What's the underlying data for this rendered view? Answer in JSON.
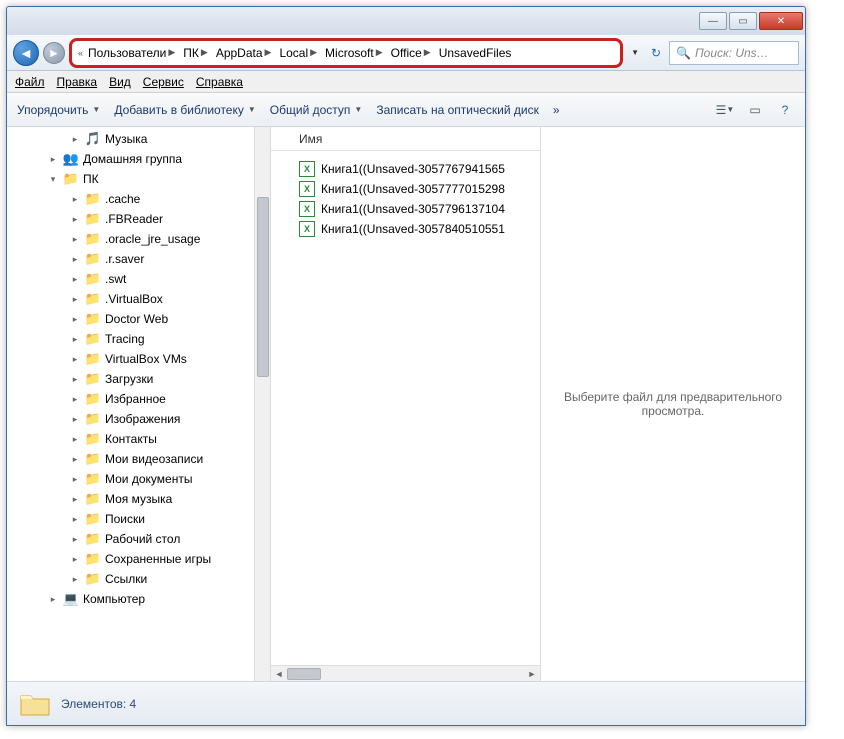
{
  "window": {
    "minimize": "—",
    "maximize": "▭",
    "close": "✕"
  },
  "breadcrumbs": {
    "prefix": "«",
    "items": [
      "Пользователи",
      "ПК",
      "AppData",
      "Local",
      "Microsoft",
      "Office",
      "UnsavedFiles"
    ]
  },
  "search": {
    "placeholder": "Поиск: Uns…"
  },
  "menubar": {
    "file": "Файл",
    "edit": "Правка",
    "view": "Вид",
    "service": "Сервис",
    "help": "Справка"
  },
  "toolbar": {
    "organize": "Упорядочить",
    "add_to_library": "Добавить в библиотеку",
    "share": "Общий доступ",
    "burn": "Записать на оптический диск",
    "more": "»"
  },
  "sidebar": {
    "items": [
      {
        "label": "Музыка",
        "icon": "🎵",
        "indent": 2
      },
      {
        "label": "Домашняя группа",
        "icon": "👥",
        "indent": 1
      },
      {
        "label": "ПК",
        "icon": "📁",
        "indent": 1,
        "expanded": true
      },
      {
        "label": ".cache",
        "icon": "📁",
        "indent": 2
      },
      {
        "label": ".FBReader",
        "icon": "📁",
        "indent": 2
      },
      {
        "label": ".oracle_jre_usage",
        "icon": "📁",
        "indent": 2
      },
      {
        "label": ".r.saver",
        "icon": "📁",
        "indent": 2
      },
      {
        "label": ".swt",
        "icon": "📁",
        "indent": 2
      },
      {
        "label": ".VirtualBox",
        "icon": "📁",
        "indent": 2
      },
      {
        "label": "Doctor Web",
        "icon": "📁",
        "indent": 2
      },
      {
        "label": "Tracing",
        "icon": "📁",
        "indent": 2
      },
      {
        "label": "VirtualBox VMs",
        "icon": "📁",
        "indent": 2
      },
      {
        "label": "Загрузки",
        "icon": "📁",
        "indent": 2
      },
      {
        "label": "Избранное",
        "icon": "📁",
        "indent": 2
      },
      {
        "label": "Изображения",
        "icon": "📁",
        "indent": 2
      },
      {
        "label": "Контакты",
        "icon": "📁",
        "indent": 2
      },
      {
        "label": "Мои видеозаписи",
        "icon": "📁",
        "indent": 2
      },
      {
        "label": "Мои документы",
        "icon": "📁",
        "indent": 2
      },
      {
        "label": "Моя музыка",
        "icon": "📁",
        "indent": 2
      },
      {
        "label": "Поиски",
        "icon": "📁",
        "indent": 2
      },
      {
        "label": "Рабочий стол",
        "icon": "📁",
        "indent": 2
      },
      {
        "label": "Сохраненные игры",
        "icon": "📁",
        "indent": 2
      },
      {
        "label": "Ссылки",
        "icon": "📁",
        "indent": 2
      },
      {
        "label": "Компьютер",
        "icon": "💻",
        "indent": 1
      }
    ]
  },
  "filelist": {
    "header_name": "Имя",
    "files": [
      "Книга1((Unsaved-3057767941565",
      "Книга1((Unsaved-3057777015298",
      "Книга1((Unsaved-3057796137104",
      "Книга1((Unsaved-3057840510551"
    ]
  },
  "preview": {
    "empty_text": "Выберите файл для предварительного просмотра."
  },
  "statusbar": {
    "text": "Элементов: 4"
  }
}
